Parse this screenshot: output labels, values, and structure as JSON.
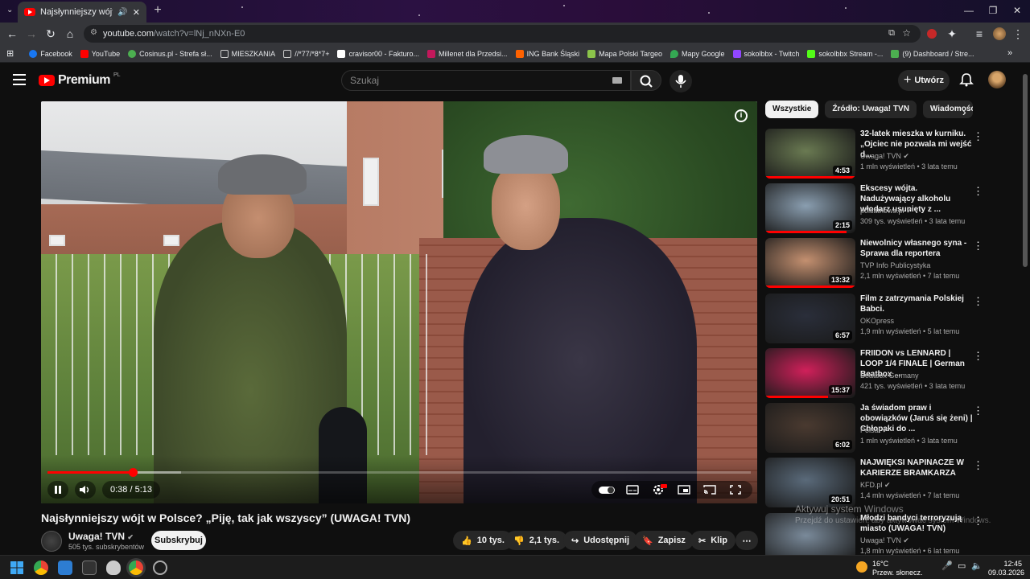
{
  "browser": {
    "tab_title": "Najsłynniejszy wójt w Polsc",
    "url_host": "youtube.com",
    "url_path": "/watch?v=lNj_nNXn-E0",
    "bookmarks": [
      {
        "label": "Facebook",
        "color": "#1877f2"
      },
      {
        "label": "YouTube",
        "color": "#ff0000"
      },
      {
        "label": "Cosinus.pl - Strefa sł...",
        "color": "#4caf50"
      },
      {
        "label": "MIESZKANIA",
        "color": "folder"
      },
      {
        "label": "//*77/*8*7+",
        "color": "folder"
      },
      {
        "label": "cravisor00 - Fakturo...",
        "color": "#ffffff"
      },
      {
        "label": "Millenet dla Przedsi...",
        "color": "#c2185b"
      },
      {
        "label": "ING Bank Śląski",
        "color": "#ff6200"
      },
      {
        "label": "Mapa Polski Targeo",
        "color": "#8bc34a"
      },
      {
        "label": "Mapy Google",
        "color": "#34a853"
      },
      {
        "label": "sokolbbx - Twitch",
        "color": "#9146ff"
      },
      {
        "label": "sokolbbx Stream -...",
        "color": "#53fc18"
      },
      {
        "label": "(9) Dashboard / Stre...",
        "color": "#4caf50"
      }
    ]
  },
  "youtube": {
    "logo_text": "Premium",
    "logo_sup": "PL",
    "search_placeholder": "Szukaj",
    "create_label": "Utwórz"
  },
  "player": {
    "time": "0:38 / 5:13",
    "progress": 0.121,
    "buffered": 0.19
  },
  "video": {
    "title": "Najsłynniejszy wójt w Polsce? „Piję, tak jak wszyscy” (UWAGA! TVN)",
    "channel": "Uwaga! TVN",
    "subscribers": "505 tys. subskrybentów",
    "subscribe_label": "Subskrybuj",
    "likes": "10 tys.",
    "dislikes": "2,1 tys.",
    "share_label": "Udostępnij",
    "save_label": "Zapisz",
    "clip_label": "Klip"
  },
  "chips": [
    "Wszystkie",
    "Źródło: Uwaga! TVN",
    "Wiadomości"
  ],
  "recommendations": [
    {
      "title": "32-latek mieszka w kurniku. „Ojciec nie pozwala mi wejść d...",
      "channel": "Uwaga! TVN",
      "meta": "1 mln wyświetleń • 3 lata temu",
      "duration": "4:53",
      "verified": true,
      "watched": 1.0,
      "color": "#6a7a52"
    },
    {
      "title": "Ekscesy wójta. Nadużywający alkoholu włodarz usunięty z ...",
      "channel": "polsatnews.pl",
      "meta": "309 tys. wyświetleń • 3 lata temu",
      "duration": "2:15",
      "verified": true,
      "watched": 0.9,
      "color": "#8a9eb0"
    },
    {
      "title": "Niewolnicy własnego syna - Sprawa dla reportera",
      "channel": "TVP Info Publicystyka",
      "meta": "2,1 mln wyświetleń • 7 lat temu",
      "duration": "13:32",
      "verified": false,
      "watched": 1.0,
      "color": "#c49070"
    },
    {
      "title": "Film z zatrzymania Polskiej Babci.",
      "channel": "OKOpress",
      "meta": "1,9 mln wyświetleń • 5 lat temu",
      "duration": "6:57",
      "verified": false,
      "watched": 0.0,
      "color": "#2a2e3a"
    },
    {
      "title": "FRIIDON vs LENNARD | LOOP 1/4 FINALE | German Beatbox ...",
      "channel": "Beatbox Germany",
      "meta": "421 tys. wyświetleń • 3 lata temu",
      "duration": "15:37",
      "verified": false,
      "watched": 0.7,
      "color": "#d0205a"
    },
    {
      "title": "Ja świadom praw i obowiązków (Jaruś się żeni) | Chłopaki do ...",
      "channel": "Polsat",
      "meta": "1 mln wyświetleń • 3 lata temu",
      "duration": "6:02",
      "verified": true,
      "watched": 0.0,
      "color": "#4a3a30"
    },
    {
      "title": "NAJWIĘKSI NAPINACZE W KARIERZE BRAMKARZA",
      "channel": "KFD.pl",
      "meta": "1,4 mln wyświetleń • 7 lat temu",
      "duration": "20:51",
      "verified": true,
      "watched": 0.0,
      "color": "#5a6a7a"
    },
    {
      "title": "Młodzi bandyci terroryzują miasto (UWAGA! TVN)",
      "channel": "Uwaga! TVN",
      "meta": "1,8 mln wyświetleń • 6 lat temu",
      "duration": "",
      "verified": true,
      "watched": 0.0,
      "color": "#7a8a9a"
    }
  ],
  "watermark": {
    "line1": "Aktywuj system Windows",
    "line2": "Przejdź do ustawień, aby aktywować system Windows."
  },
  "taskbar": {
    "weather_temp": "16°C",
    "weather_desc": "Przew. słonecz.",
    "time": "12:45",
    "date": "09.03.2026"
  }
}
